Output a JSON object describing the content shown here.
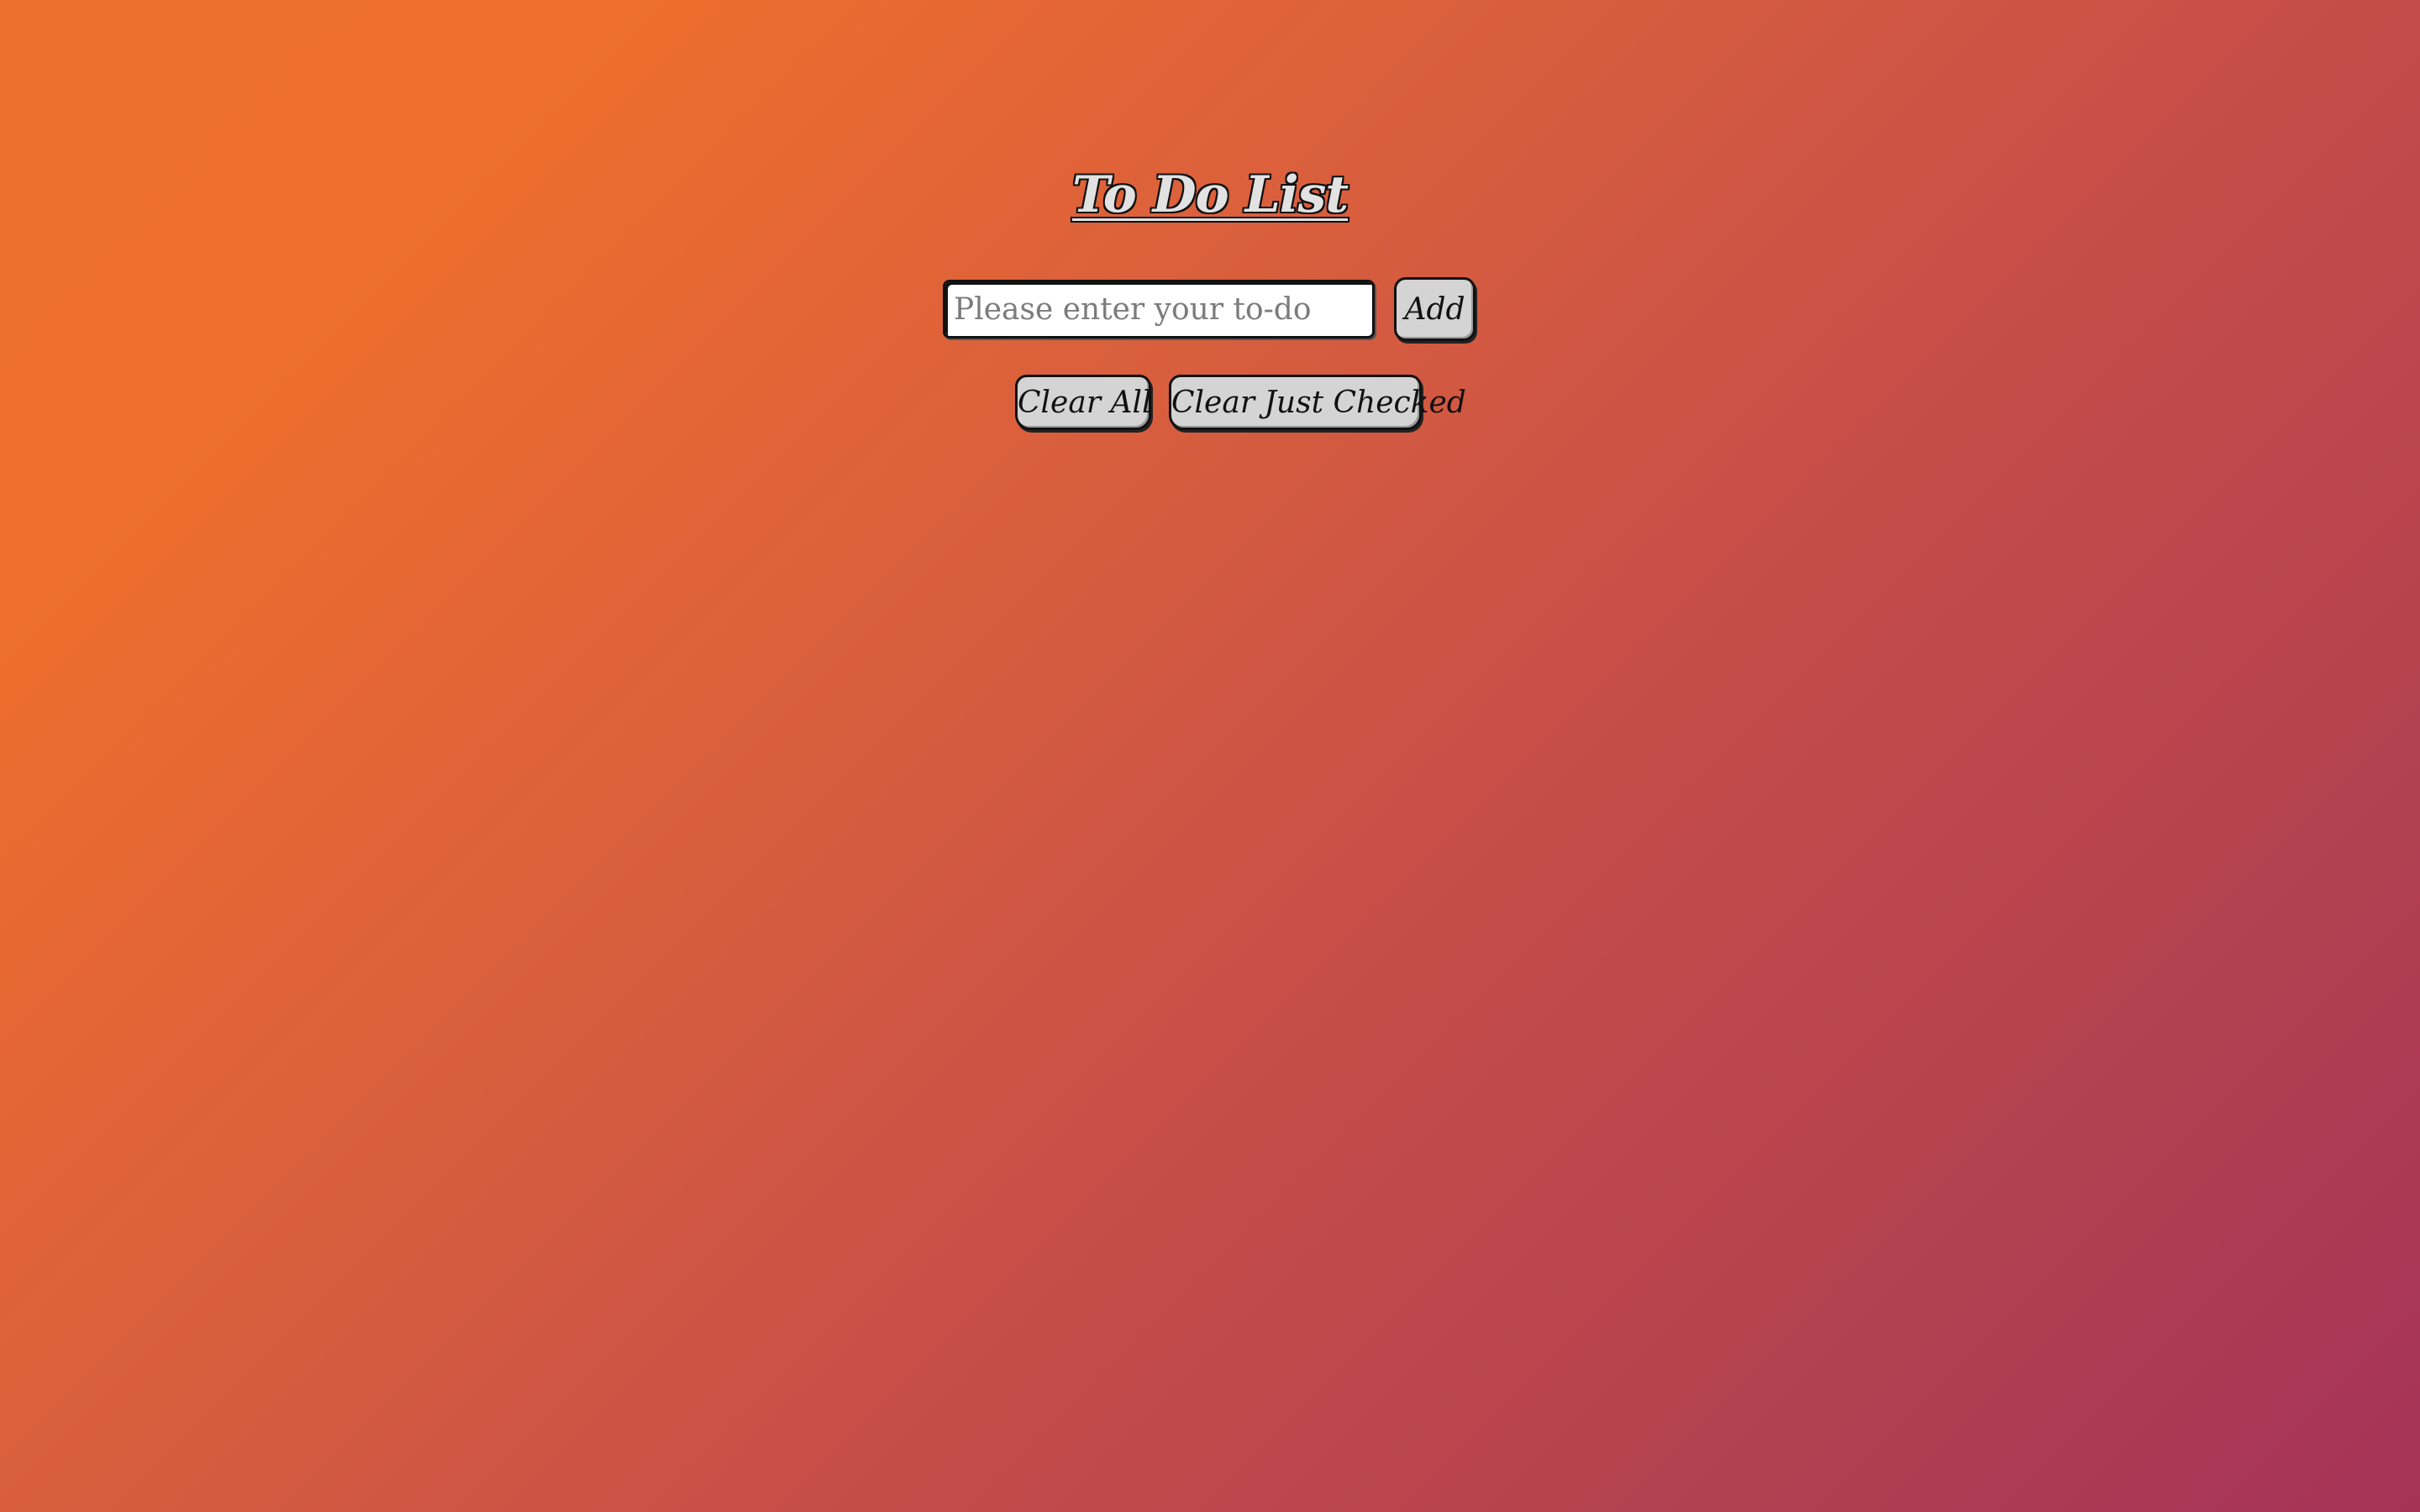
{
  "app": {
    "title": "To Do List"
  },
  "input": {
    "placeholder": "Please enter your to-do",
    "value": ""
  },
  "buttons": {
    "add_label": "Add",
    "clear_all_label": "Clear All",
    "clear_checked_label": "Clear Just Checked"
  },
  "todos": [],
  "colors": {
    "gradient_start": "#ef6e2d",
    "gradient_end": "#a53358",
    "button_bg": "#d4d4d4",
    "outline": "#111111"
  }
}
